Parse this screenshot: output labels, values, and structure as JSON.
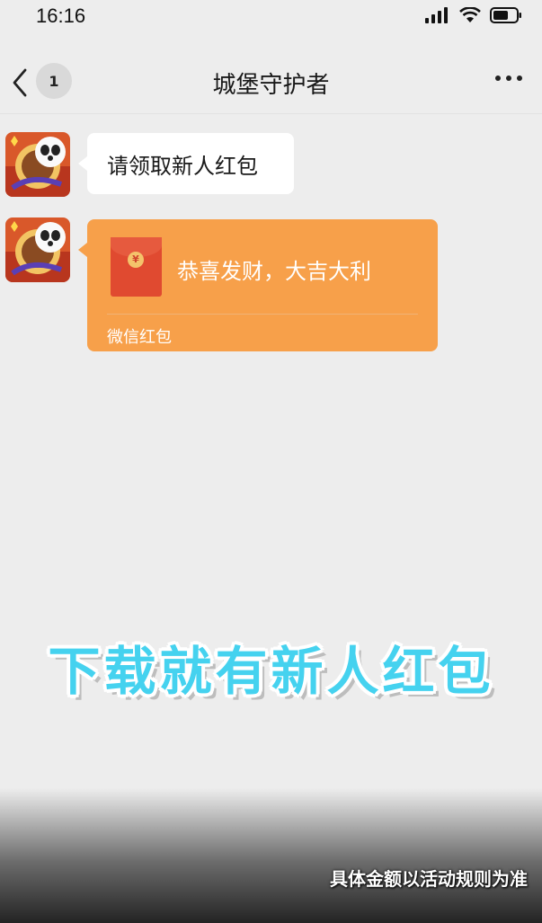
{
  "status_bar": {
    "time": "16:16"
  },
  "nav": {
    "unread_count": "1",
    "title": "城堡守护者"
  },
  "messages": [
    {
      "type": "text",
      "text": "请领取新人红包"
    },
    {
      "type": "red_packet",
      "symbol": "¥",
      "message": "恭喜发财，大吉大利",
      "footer": "微信红包"
    }
  ],
  "overlay": {
    "promo_text": "下载就有新人红包",
    "disclaimer": "具体金额以活动规则为准"
  },
  "colors": {
    "background": "#ededed",
    "red_packet": "#f7a04a",
    "promo": "#45d2ef"
  }
}
